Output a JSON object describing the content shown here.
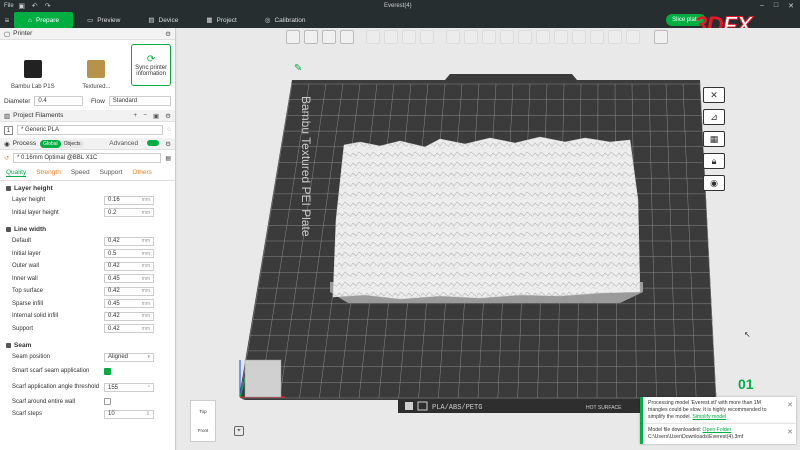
{
  "window": {
    "file_menu": "File",
    "title": "Everest(4)"
  },
  "nav": {
    "tabs": [
      {
        "label": "Prepare",
        "active": true
      },
      {
        "label": "Preview",
        "active": false
      },
      {
        "label": "Device",
        "active": false
      },
      {
        "label": "Project",
        "active": false
      },
      {
        "label": "Calibration",
        "active": false
      }
    ],
    "slice_label": "Slice plate"
  },
  "brand": {
    "logo_text": "3D",
    "logo_outline": "FX"
  },
  "printer": {
    "header": "Printer",
    "printer_name": "Bambu Lab P1S",
    "plate_name": "Textured...",
    "sync_label": "Sync printer information",
    "diameter_label": "Diameter",
    "diameter_value": "0.4",
    "flow_label": "Flow",
    "flow_value": "Standard"
  },
  "filaments": {
    "header": "Project Filaments",
    "items": [
      {
        "num": "1",
        "name": "* Generic PLA"
      }
    ]
  },
  "process": {
    "header": "Process",
    "toggle_global": "Global",
    "toggle_objects": "Objects",
    "advanced_label": "Advanced",
    "profile": "* 0.16mm Optimal @BBL X1C",
    "tabs": [
      {
        "label": "Quality",
        "state": "active"
      },
      {
        "label": "Strength",
        "state": "orange"
      },
      {
        "label": "Speed",
        "state": "normal"
      },
      {
        "label": "Support",
        "state": "normal"
      },
      {
        "label": "Others",
        "state": "orange"
      }
    ]
  },
  "settings": {
    "layer_height_group": "Layer height",
    "layer_height": {
      "label": "Layer height",
      "value": "0.16",
      "unit": "mm"
    },
    "initial_layer_height": {
      "label": "Initial layer height",
      "value": "0.2",
      "unit": "mm"
    },
    "line_width_group": "Line width",
    "line_widths": [
      {
        "label": "Default",
        "value": "0.42",
        "unit": "mm"
      },
      {
        "label": "Initial layer",
        "value": "0.5",
        "unit": "mm"
      },
      {
        "label": "Outer wall",
        "value": "0.42",
        "unit": "mm"
      },
      {
        "label": "Inner wall",
        "value": "0.45",
        "unit": "mm"
      },
      {
        "label": "Top surface",
        "value": "0.42",
        "unit": "mm"
      },
      {
        "label": "Sparse infill",
        "value": "0.45",
        "unit": "mm"
      },
      {
        "label": "Internal solid infill",
        "value": "0.42",
        "unit": "mm"
      },
      {
        "label": "Support",
        "value": "0.42",
        "unit": "mm"
      }
    ],
    "seam_group": "Seam",
    "seam_position": {
      "label": "Seam position",
      "value": "Aligned"
    },
    "smart_scarf": {
      "label": "Smart scarf seam application"
    },
    "scarf_threshold": {
      "label": "Scarf application angle threshold",
      "value": "155",
      "unit": "°"
    },
    "scarf_entire": {
      "label": "Scarf around entire wall"
    },
    "scarf_steps": {
      "label": "Scarf steps",
      "value": "10"
    }
  },
  "plate": {
    "brand_text": "Bambu Textured PEI Plate",
    "materials_text": "PLA/ABS/PETG",
    "surface_text": "HOT SURFACE",
    "plate_number": "01"
  },
  "viewcube": {
    "top": "Top",
    "front": "Front"
  },
  "notifications": [
    {
      "text": "Processing model 'Everest.stl' with more than 1M triangles could be slow. It is highly recommended to simplify the model.",
      "link": "Simplify model"
    },
    {
      "text": "Model file downloaded:",
      "link": "Open Folder",
      "path": "C:\\Users\\User\\Downloads\\Everest(4).3mf"
    }
  ],
  "colors": {
    "accent": "#00ae42",
    "plate": "#3b3b3b",
    "grid": "#8a8a8a",
    "model": "#efefef"
  }
}
